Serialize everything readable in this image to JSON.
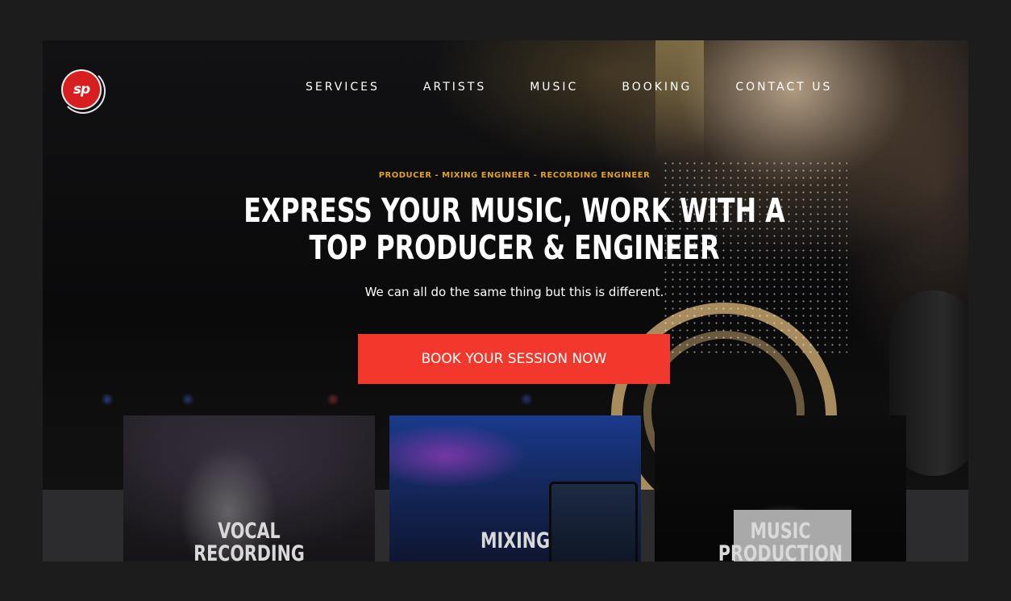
{
  "nav": {
    "logo_text": "sp",
    "items": [
      "SERVICES",
      "ARTISTS",
      "MUSIC",
      "BOOKING",
      "CONTACT US"
    ]
  },
  "hero": {
    "tagline": "PRODUCER - MIXING ENGINEER - RECORDING ENGINEER",
    "headline_line1": "EXPRESS YOUR MUSIC, WORK WITH A",
    "headline_line2": "TOP PRODUCER & ENGINEER",
    "subtitle": "We can all do the same thing but this is different.",
    "cta_label": "BOOK YOUR SESSION NOW"
  },
  "services": [
    {
      "title_line1": "VOCAL",
      "title_line2": "RECORDING"
    },
    {
      "title_line1": "MIXING",
      "title_line2": ""
    },
    {
      "title_line1": "MUSIC",
      "title_line2": "PRODUCTION"
    }
  ],
  "colors": {
    "accent": "#f2382c",
    "tagline": "#e0a21a",
    "logo": "#d71f1f"
  }
}
